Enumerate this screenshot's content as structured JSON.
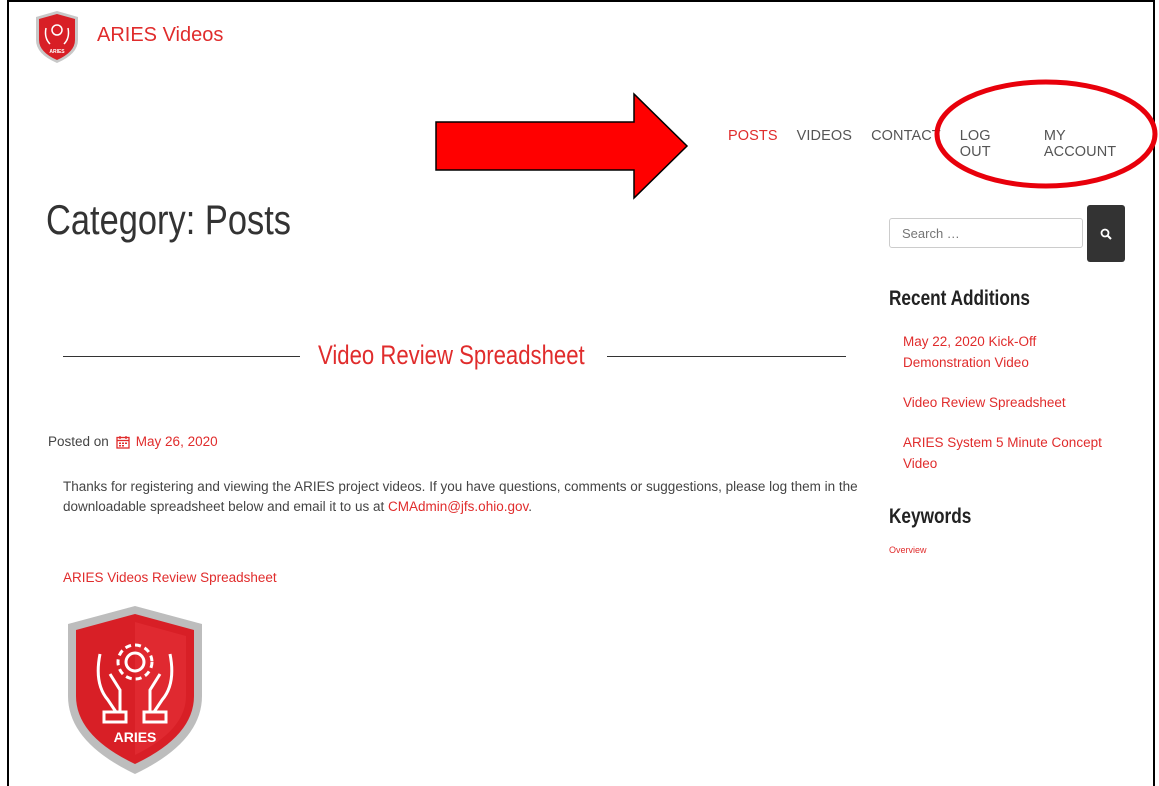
{
  "site": {
    "title": "ARIES Videos",
    "logo_text": "ARIES"
  },
  "nav": {
    "items": [
      {
        "label": "POSTS",
        "active": true
      },
      {
        "label": "VIDEOS",
        "active": false
      },
      {
        "label": "CONTACT",
        "active": false
      },
      {
        "label": "LOG OUT",
        "active": false
      },
      {
        "label": "MY ACCOUNT",
        "active": false
      }
    ]
  },
  "annotations": {
    "arrow_color": "#ff0000",
    "ellipse_color": "#e8000b"
  },
  "page": {
    "title": "Category: Posts"
  },
  "post": {
    "title": "Video Review Spreadsheet",
    "posted_prefix": "Posted on",
    "date": "May 26, 2020",
    "body_text": "Thanks for registering and viewing the ARIES project videos.  If you have questions, comments or suggestions, please log them in the downloadable spreadsheet below and email it to us at ",
    "email": "CMAdmin@jfs.ohio.gov",
    "body_end": ".",
    "download_link": "ARIES Videos Review Spreadsheet"
  },
  "sidebar": {
    "search_placeholder": "Search …",
    "recent_heading": "Recent Additions",
    "recent": [
      "May 22, 2020 Kick-Off Demonstration Video",
      "Video Review Spreadsheet",
      "ARIES System 5 Minute Concept Video"
    ],
    "keywords_heading": "Keywords",
    "keywords": [
      "Overview"
    ]
  },
  "colors": {
    "accent": "#e02c2c",
    "text": "#333333",
    "button": "#333333"
  }
}
